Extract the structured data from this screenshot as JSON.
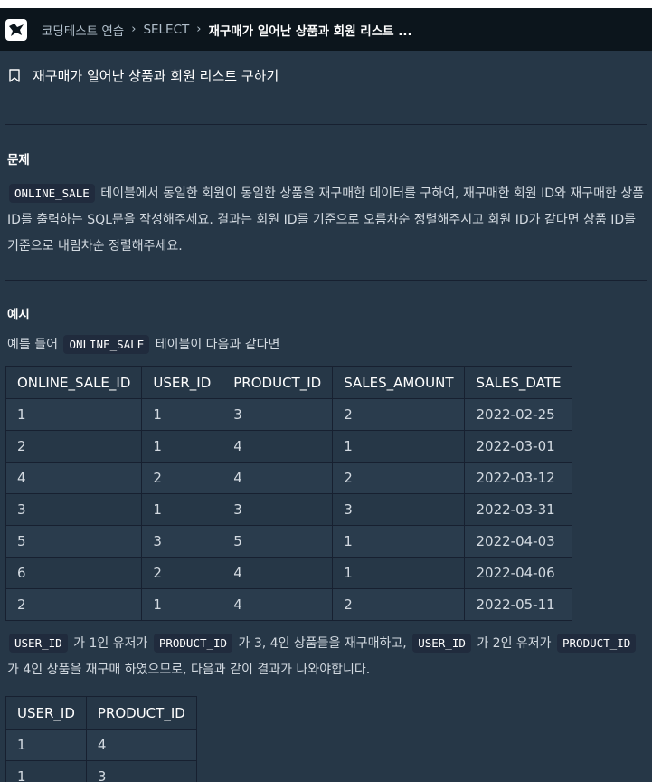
{
  "header": {
    "breadcrumb": [
      "코딩테스트 연습",
      "SELECT",
      "재구매가 일어난 상품과 회원 리스트 ..."
    ]
  },
  "problem_title": "재구매가 일어난 상품과 회원 리스트 구하기",
  "sections": {
    "problem_heading": "문제",
    "example_heading": "예시"
  },
  "problem_text": {
    "code1": "ONLINE_SALE",
    "text1": "테이블에서 동일한 회원이 동일한 상품을 재구매한 데이터를 구하여, 재구매한 회원 ID와 재구매한 상품 ID를 출력하는 SQL문을 작성해주세요. 결과는 회원 ID를 기준으로 오름차순 정렬해주시고 회원 ID가 같다면 상품 ID를 기준으로 내림차순 정렬해주세요."
  },
  "example_intro": {
    "pre": "예를 들어",
    "code": "ONLINE_SALE",
    "post": "테이블이 다음과 같다면"
  },
  "sales_table": {
    "headers": [
      "ONLINE_SALE_ID",
      "USER_ID",
      "PRODUCT_ID",
      "SALES_AMOUNT",
      "SALES_DATE"
    ],
    "rows": [
      [
        "1",
        "1",
        "3",
        "2",
        "2022-02-25"
      ],
      [
        "2",
        "1",
        "4",
        "1",
        "2022-03-01"
      ],
      [
        "4",
        "2",
        "4",
        "2",
        "2022-03-12"
      ],
      [
        "3",
        "1",
        "3",
        "3",
        "2022-03-31"
      ],
      [
        "5",
        "3",
        "5",
        "1",
        "2022-04-03"
      ],
      [
        "6",
        "2",
        "4",
        "1",
        "2022-04-06"
      ],
      [
        "2",
        "1",
        "4",
        "2",
        "2022-05-11"
      ]
    ]
  },
  "explanation": {
    "c1": "USER_ID",
    "t1": "가 1인 유저가",
    "c2": "PRODUCT_ID",
    "t2": "가 3, 4인 상품들을 재구매하고,",
    "c3": "USER_ID",
    "t3": "가 2인 유저가",
    "c4": "PRODUCT_ID",
    "t4": "가 4인 상품을 재구매 하였으므로, 다음과 같이 결과가 나와야합니다."
  },
  "result_table": {
    "headers": [
      "USER_ID",
      "PRODUCT_ID"
    ],
    "rows": [
      [
        "1",
        "4"
      ],
      [
        "1",
        "3"
      ]
    ]
  },
  "icons": {
    "logo": "programmers-logo-icon",
    "bookmark": "bookmark-icon",
    "separator": "chevron-right-icon"
  },
  "colors": {
    "background": "#263747",
    "topbar": "#0c151c",
    "code_bg": "#202b3d",
    "text": "#d3dae1"
  }
}
